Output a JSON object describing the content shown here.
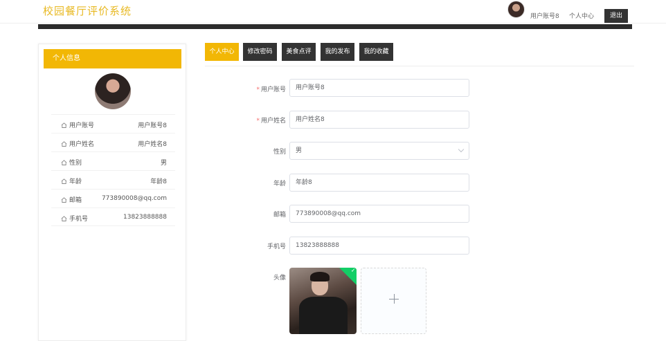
{
  "header": {
    "logo": "校园餐厅评价系统",
    "username": "用户账号8",
    "personal_center": "个人中心",
    "logout": "退出"
  },
  "left_panel": {
    "title": "个人信息",
    "rows": [
      {
        "label": "用户账号",
        "value": "用户账号8"
      },
      {
        "label": "用户姓名",
        "value": "用户姓名8"
      },
      {
        "label": "性别",
        "value": "男"
      },
      {
        "label": "年龄",
        "value": "年龄8"
      },
      {
        "label": "邮箱",
        "value": "773890008@qq.com"
      },
      {
        "label": "手机号",
        "value": "13823888888"
      }
    ]
  },
  "tabs": [
    {
      "label": "个人中心",
      "active": true
    },
    {
      "label": "修改密码",
      "active": false
    },
    {
      "label": "美食点评",
      "active": false
    },
    {
      "label": "我的发布",
      "active": false
    },
    {
      "label": "我的收藏",
      "active": false
    }
  ],
  "form": {
    "username": {
      "label": "用户账号",
      "value": "用户账号8",
      "required": true
    },
    "name": {
      "label": "用户姓名",
      "value": "用户姓名8",
      "required": true
    },
    "gender": {
      "label": "性别",
      "value": "男"
    },
    "age": {
      "label": "年龄",
      "value": "年龄8"
    },
    "email": {
      "label": "邮箱",
      "value": "773890008@qq.com"
    },
    "phone": {
      "label": "手机号",
      "value": "13823888888"
    },
    "avatar": {
      "label": "头像"
    }
  },
  "colors": {
    "accent": "#f2b705",
    "dark": "#333333",
    "required": "#f56c6c",
    "success": "#13ce66"
  }
}
